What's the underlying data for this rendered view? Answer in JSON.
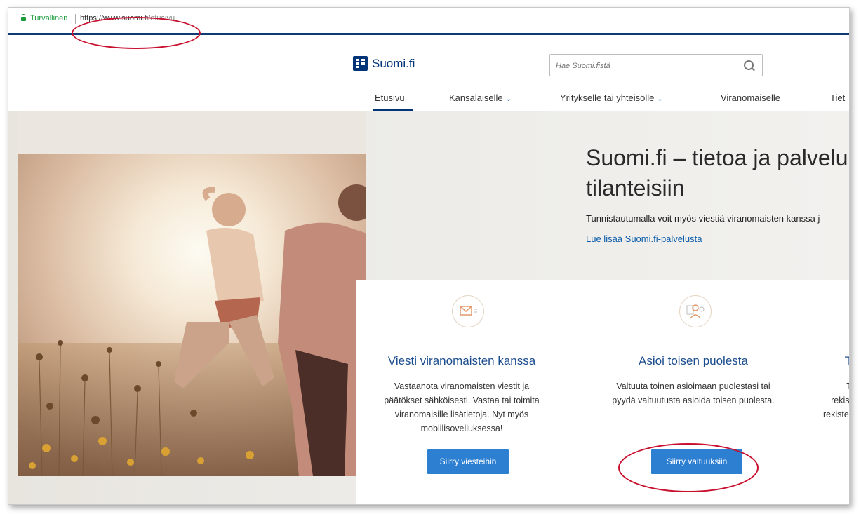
{
  "browser": {
    "secure_label": "Turvallinen",
    "url_host": "https://www.suomi.fi",
    "url_path": "/etusivu"
  },
  "header": {
    "logo_text": "Suomi.fi",
    "search_placeholder": "Hae Suomi.fistä"
  },
  "nav": {
    "items": [
      {
        "label": "Etusivu",
        "chevron": false,
        "active": true
      },
      {
        "label": "Kansalaiselle",
        "chevron": true
      },
      {
        "label": "Yritykselle tai yhteisölle",
        "chevron": true
      },
      {
        "label": "Viranomaiselle",
        "chevron": false
      },
      {
        "label": "Tiet",
        "chevron": false
      }
    ]
  },
  "hero": {
    "title_line1": "Suomi.fi – tietoa ja palvelu",
    "title_line2": "tilanteisiin",
    "text": "Tunnistautumalla voit myös viestiä viranomaisten kanssa j",
    "link": "Lue lisää Suomi.fi-palvelusta"
  },
  "cards": [
    {
      "icon": "envelope-icon",
      "title": "Viesti viranomaisten kanssa",
      "text_lines": [
        "Vastaanota viranomaisten viestit ja",
        "päätökset sähköisesti. Vastaa tai toimita",
        "viranomaisille lisätietoja. Nyt myös",
        "mobiilisovelluksessa!"
      ],
      "button": "Siirry viesteihin"
    },
    {
      "icon": "people-icon",
      "title": "Asioi toisen puolesta",
      "text_lines": [
        "Valtuuta toinen asioimaan puolestasi tai",
        "pyydä valtuutusta asioida toisen puolesta."
      ],
      "button": "Siirry valtuuksiin"
    },
    {
      "title": "T",
      "text_lines": [
        "T",
        "rekist",
        "rekister"
      ]
    }
  ],
  "colors": {
    "brand": "#003479",
    "button": "#2d7fd2",
    "annotation": "#c8102e",
    "secure": "#1a9a3a"
  }
}
